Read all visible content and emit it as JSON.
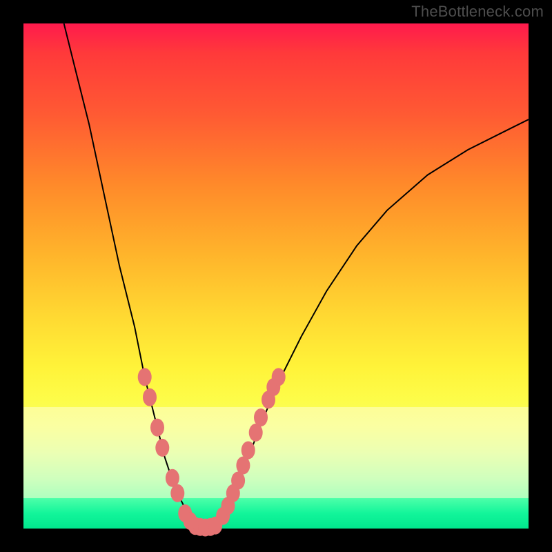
{
  "watermark": "TheBottleneck.com",
  "colors": {
    "background": "#000000",
    "curve": "#000000",
    "marker": "#e57373",
    "gradient_top": "#ff1a4d",
    "gradient_bottom": "#01e78e"
  },
  "chart_data": {
    "type": "line",
    "title": "",
    "xlabel": "",
    "ylabel": "",
    "xlim": [
      0,
      100
    ],
    "ylim": [
      0,
      100
    ],
    "note": "Axes unlabeled in source image; values are visual estimates on a 0–100 scale where y=100 is top (red / high bottleneck) and y=0 is bottom (green / balanced).",
    "curve": [
      {
        "x": 8,
        "y": 100
      },
      {
        "x": 10,
        "y": 92
      },
      {
        "x": 13,
        "y": 80
      },
      {
        "x": 16,
        "y": 66
      },
      {
        "x": 19,
        "y": 52
      },
      {
        "x": 22,
        "y": 40
      },
      {
        "x": 24,
        "y": 30
      },
      {
        "x": 26,
        "y": 22
      },
      {
        "x": 28,
        "y": 14
      },
      {
        "x": 30,
        "y": 8
      },
      {
        "x": 32,
        "y": 4
      },
      {
        "x": 34,
        "y": 1
      },
      {
        "x": 36,
        "y": 0
      },
      {
        "x": 38,
        "y": 1
      },
      {
        "x": 40,
        "y": 4
      },
      {
        "x": 43,
        "y": 10
      },
      {
        "x": 46,
        "y": 18
      },
      {
        "x": 50,
        "y": 28
      },
      {
        "x": 55,
        "y": 38
      },
      {
        "x": 60,
        "y": 47
      },
      {
        "x": 66,
        "y": 56
      },
      {
        "x": 72,
        "y": 63
      },
      {
        "x": 80,
        "y": 70
      },
      {
        "x": 88,
        "y": 75
      },
      {
        "x": 96,
        "y": 79
      },
      {
        "x": 100,
        "y": 81
      }
    ],
    "markers_left": [
      {
        "x": 24.0,
        "y": 30
      },
      {
        "x": 25.0,
        "y": 26
      },
      {
        "x": 26.5,
        "y": 20
      },
      {
        "x": 27.5,
        "y": 16
      },
      {
        "x": 29.5,
        "y": 10
      },
      {
        "x": 30.5,
        "y": 7
      },
      {
        "x": 32.0,
        "y": 3
      },
      {
        "x": 33.0,
        "y": 1.5
      }
    ],
    "markers_bottom": [
      {
        "x": 34.0,
        "y": 0.5
      },
      {
        "x": 35.0,
        "y": 0.3
      },
      {
        "x": 36.0,
        "y": 0.2
      },
      {
        "x": 37.0,
        "y": 0.3
      },
      {
        "x": 38.0,
        "y": 0.6
      }
    ],
    "markers_right": [
      {
        "x": 39.5,
        "y": 2.5
      },
      {
        "x": 40.5,
        "y": 4.5
      },
      {
        "x": 41.5,
        "y": 7
      },
      {
        "x": 42.5,
        "y": 9.5
      },
      {
        "x": 43.5,
        "y": 12.5
      },
      {
        "x": 44.5,
        "y": 15.5
      },
      {
        "x": 46.0,
        "y": 19
      },
      {
        "x": 47.0,
        "y": 22
      },
      {
        "x": 48.5,
        "y": 25.5
      },
      {
        "x": 49.5,
        "y": 28
      },
      {
        "x": 50.5,
        "y": 30
      }
    ],
    "highlight_band": {
      "y_top": 24,
      "y_bottom": 6
    }
  }
}
